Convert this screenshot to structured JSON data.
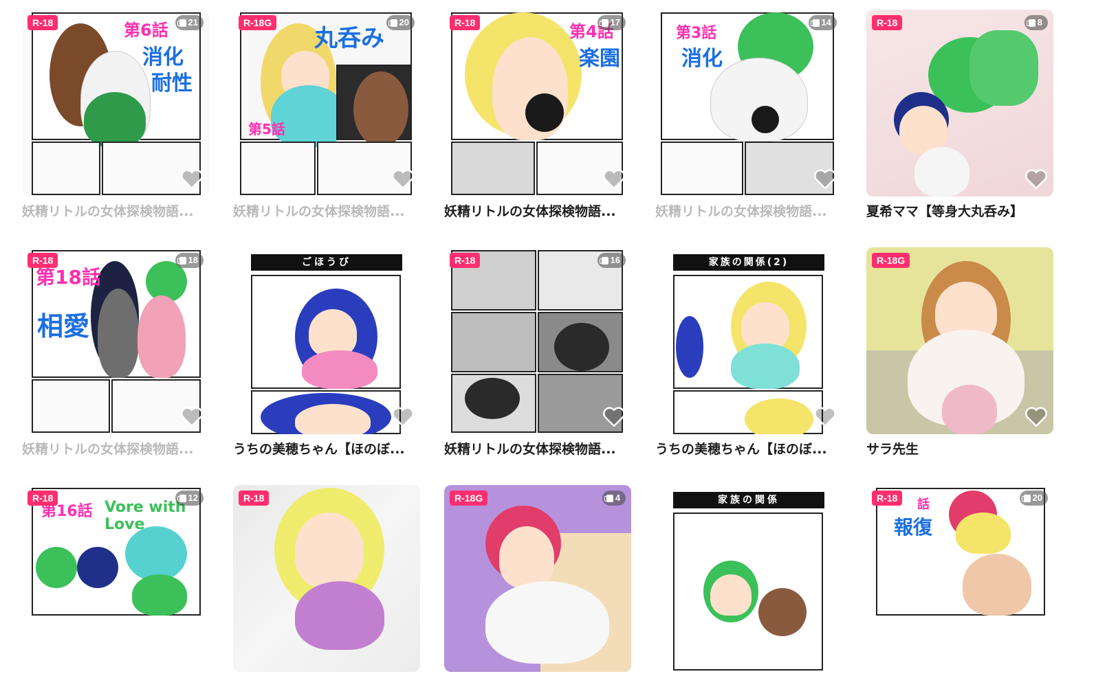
{
  "cards": [
    {
      "badge": "R-18",
      "count": "21",
      "title": "妖精リトルの女体探検物語...",
      "dim": true,
      "overlay_text": [
        "第6話",
        "消化",
        "耐性"
      ]
    },
    {
      "badge": "R-18G",
      "count": "20",
      "title": "妖精リトルの女体探検物語...",
      "dim": true,
      "overlay_text": [
        "丸呑み",
        "第5話"
      ]
    },
    {
      "badge": "R-18",
      "count": "17",
      "title": "妖精リトルの女体探検物語...",
      "dim": false,
      "overlay_text": [
        "第4話",
        "楽園"
      ]
    },
    {
      "badge": "",
      "count": "14",
      "title": "妖精リトルの女体探検物語...",
      "dim": true,
      "overlay_text": [
        "第3話",
        "消化"
      ]
    },
    {
      "badge": "R-18",
      "count": "8",
      "title": "夏希ママ【等身大丸呑み】",
      "dim": false,
      "overlay_text": []
    },
    {
      "badge": "R-18",
      "count": "18",
      "title": "妖精リトルの女体探検物語...",
      "dim": true,
      "overlay_text": [
        "第18話",
        "相愛"
      ]
    },
    {
      "badge": "",
      "count": "",
      "title": "うちの美穂ちゃん【ほのぼ...",
      "dim": false,
      "overlay_text": [
        "ごほうび"
      ]
    },
    {
      "badge": "R-18",
      "count": "16",
      "title": "妖精リトルの女体探検物語...",
      "dim": false,
      "overlay_text": []
    },
    {
      "badge": "",
      "count": "",
      "title": "うちの美穂ちゃん【ほのぼ...",
      "dim": false,
      "overlay_text": [
        "家族の関係(2)"
      ]
    },
    {
      "badge": "R-18G",
      "count": "",
      "title": "サラ先生",
      "dim": false,
      "overlay_text": []
    },
    {
      "badge": "R-18",
      "count": "12",
      "title": "",
      "dim": false,
      "overlay_text": [
        "第16話",
        "Vore with Love"
      ]
    },
    {
      "badge": "R-18",
      "count": "",
      "title": "",
      "dim": false,
      "overlay_text": []
    },
    {
      "badge": "R-18G",
      "count": "4",
      "title": "",
      "dim": false,
      "overlay_text": []
    },
    {
      "badge": "",
      "count": "",
      "title": "",
      "dim": false,
      "overlay_text": [
        "家族の関係"
      ]
    },
    {
      "badge": "R-18",
      "count": "20",
      "title": "",
      "dim": false,
      "overlay_text": [
        "話",
        "報復"
      ]
    }
  ],
  "colors": {
    "badge": "#ff2e6e",
    "title": "#1d1d1d",
    "title_dim": "#b9b9b9"
  }
}
